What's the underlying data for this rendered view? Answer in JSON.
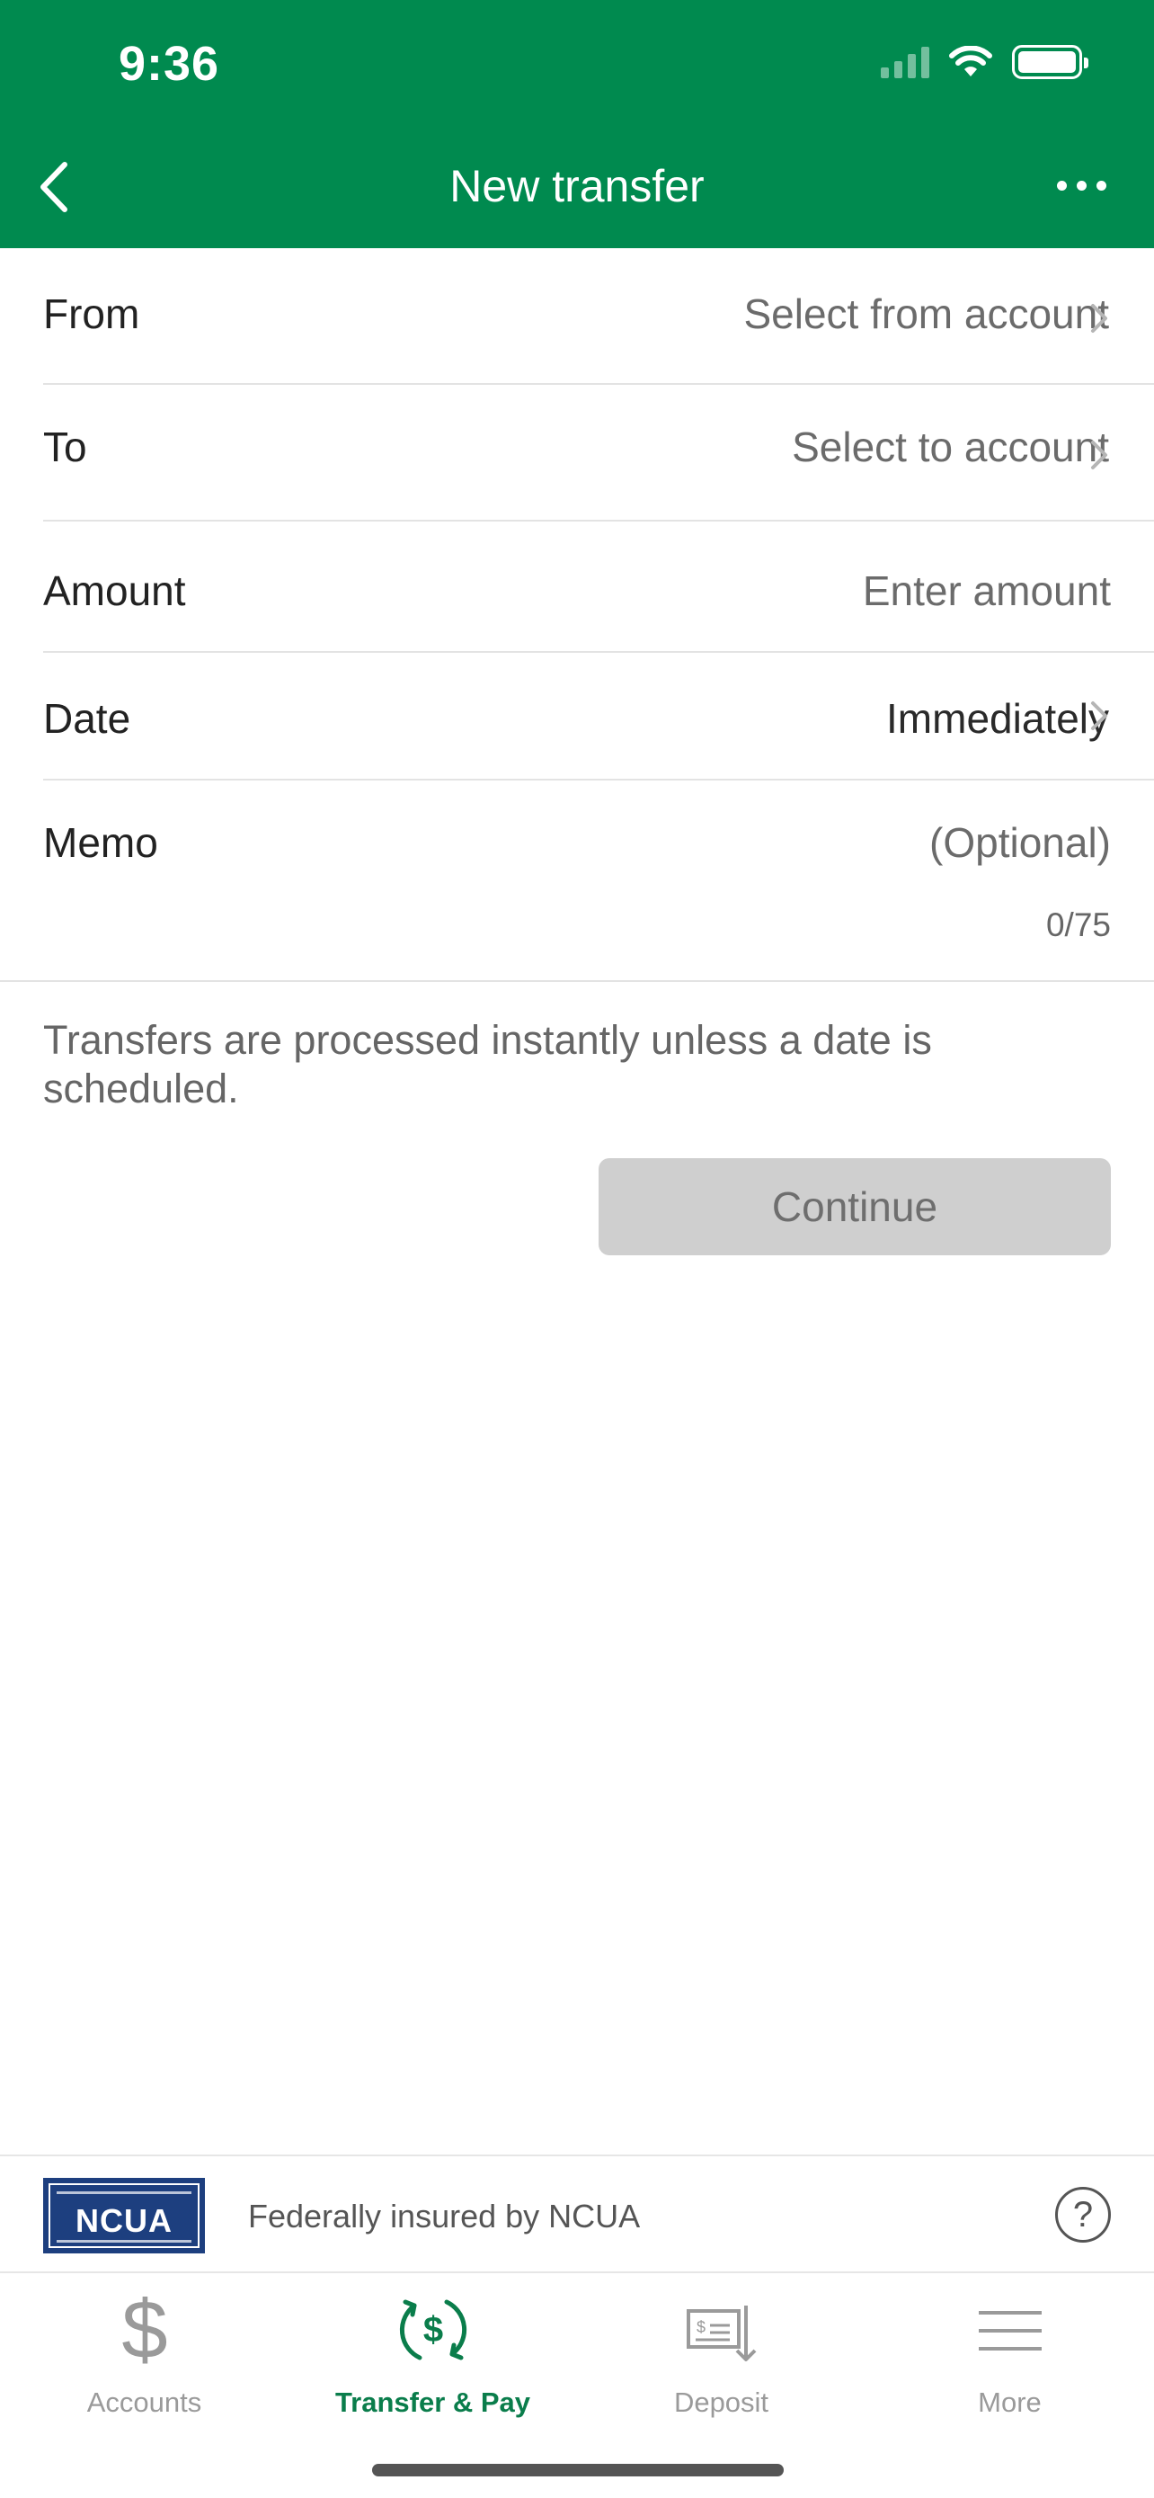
{
  "status_bar": {
    "time": "9:36"
  },
  "nav": {
    "title": "New transfer"
  },
  "form": {
    "from": {
      "label": "From",
      "value": "Select from account"
    },
    "to": {
      "label": "To",
      "value": "Select to account"
    },
    "amount": {
      "label": "Amount",
      "placeholder": "Enter amount"
    },
    "date": {
      "label": "Date",
      "value": "Immediately"
    },
    "memo": {
      "label": "Memo",
      "placeholder": "(Optional)",
      "counter": "0/75"
    }
  },
  "info_text": "Transfers are processed instantly unless a date is scheduled.",
  "continue_label": "Continue",
  "ncua": {
    "logo_text": "NCUA",
    "text": "Federally insured by NCUA"
  },
  "tabs": [
    {
      "label": "Accounts",
      "icon": "dollar-icon",
      "active": false
    },
    {
      "label": "Transfer & Pay",
      "icon": "transfer-pay-icon",
      "active": true
    },
    {
      "label": "Deposit",
      "icon": "deposit-check-icon",
      "active": false
    },
    {
      "label": "More",
      "icon": "menu-icon",
      "active": false
    }
  ],
  "colors": {
    "brand_green": "#008a4f",
    "active_tab": "#0a7d4b",
    "disabled_button": "#cfcfcf"
  }
}
